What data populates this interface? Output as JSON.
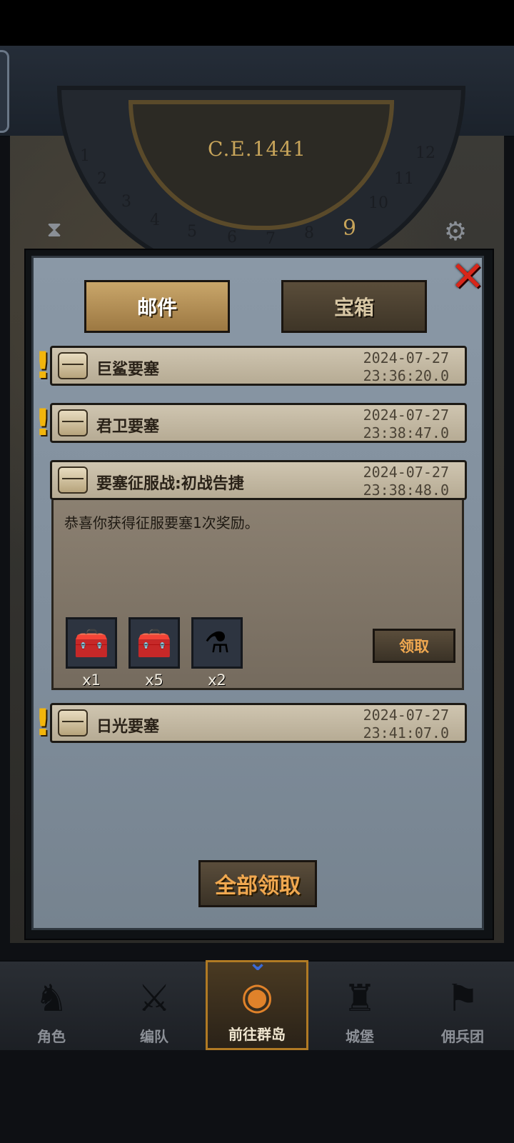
{
  "header": {
    "year": "C.E.1441",
    "dial_numbers": [
      "1",
      "2",
      "3",
      "4",
      "5",
      "6",
      "7",
      "8",
      "9",
      "10",
      "11",
      "12"
    ]
  },
  "tabs": [
    {
      "label": "邮件",
      "active": true
    },
    {
      "label": "宝箱",
      "active": false
    }
  ],
  "mails": [
    {
      "title": "巨鲨要塞",
      "date": "2024-07-27",
      "time": "23:36:20.0",
      "unread": true
    },
    {
      "title": "君卫要塞",
      "date": "2024-07-27",
      "time": "23:38:47.0",
      "unread": true
    },
    {
      "title": "要塞征服战:初战告捷",
      "date": "2024-07-27",
      "time": "23:38:48.0",
      "unread": false,
      "expanded": true,
      "body": "恭喜你获得征服要塞1次奖励。",
      "rewards": [
        {
          "icon": "treasure-chest-icon",
          "count": "x1"
        },
        {
          "icon": "treasure-chest-icon",
          "count": "x5"
        },
        {
          "icon": "blue-potion-icon",
          "count": "x2"
        }
      ],
      "claim_label": "领取"
    },
    {
      "title": "日光要塞",
      "date": "2024-07-27",
      "time": "23:41:07.0",
      "unread": true
    }
  ],
  "claim_all_label": "全部领取",
  "nav": [
    {
      "label": "角色",
      "icon": "knight-icon",
      "active": false
    },
    {
      "label": "编队",
      "icon": "formation-icon",
      "active": false
    },
    {
      "label": "前往群岛",
      "icon": "globe-icon",
      "active": true
    },
    {
      "label": "城堡",
      "icon": "castle-icon",
      "active": false
    },
    {
      "label": "佣兵团",
      "icon": "mercenary-icon",
      "active": false
    }
  ],
  "colors": {
    "accent": "#f0a850",
    "alert": "#f2b50c",
    "close": "#d8261a"
  }
}
